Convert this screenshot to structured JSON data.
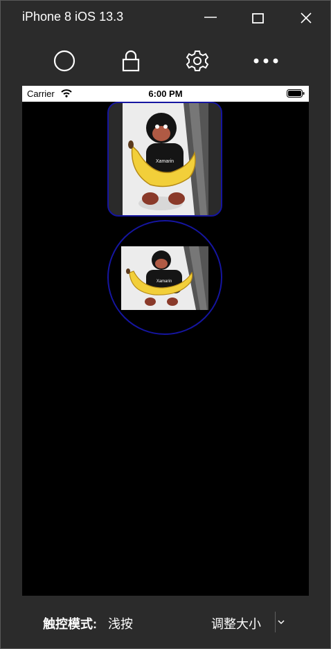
{
  "window": {
    "title": "iPhone 8 iOS 13.3",
    "minimize_icon": "minimize-icon",
    "maximize_icon": "maximize-icon",
    "close_icon": "close-icon"
  },
  "toolbar": {
    "items": [
      {
        "icon": "home-circle-icon"
      },
      {
        "icon": "lock-icon"
      },
      {
        "icon": "gear-icon"
      },
      {
        "icon": "more-icon"
      }
    ]
  },
  "device": {
    "status_bar": {
      "carrier": "Carrier",
      "time": "6:00 PM",
      "wifi_icon": "wifi-icon",
      "battery_icon": "battery-icon"
    },
    "images": [
      {
        "shape": "rounded-rectangle",
        "subject": "plush monkey holding banana",
        "shirt_text": "Xamarin"
      },
      {
        "shape": "circle",
        "subject": "plush monkey holding banana",
        "shirt_text": "Xamarin"
      }
    ],
    "frame_border_color": "#1515a0",
    "background_color": "#000000"
  },
  "bottom_bar": {
    "touch_mode_label": "触控模式:",
    "touch_mode_value": "浅按",
    "resize_label": "调整大小",
    "dropdown_icon": "chevron-down-icon"
  },
  "colors": {
    "window_bg": "#2b2b2b",
    "text": "#ffffff"
  }
}
